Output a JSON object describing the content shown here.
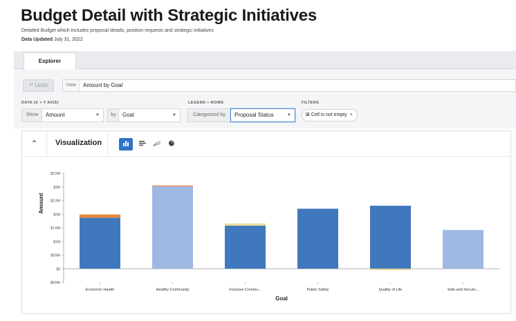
{
  "page": {
    "title": "Budget Detail with Strategic Initiatives",
    "subtitle": "Detailed Budget which includes proposal details, position requests and strategic initiatives",
    "updated_label": "Data Updated",
    "updated_value": "July 31, 2022"
  },
  "tabs": [
    {
      "label": "Explorer"
    }
  ],
  "toolbar": {
    "undo_label": "Undo",
    "undo_icon": "undo-arrow-icon",
    "view_label": "View",
    "view_value": "Amount by Goal"
  },
  "controls": {
    "data_label": "DATA (X + Y AXIS)",
    "show_label": "Show",
    "show_value": "Amount",
    "by_label": "by",
    "by_value": "Goal",
    "legend_label": "LEGEND + ROWS",
    "categorized_label": "Categorized by",
    "categorized_value": "Proposal Status",
    "filters_label": "FILTERS",
    "filter_chip": "Cell is not empty",
    "filter_icon": "filter-square-icon",
    "remove_icon": "close-icon"
  },
  "visualization": {
    "title": "Visualization",
    "collapse_icon": "chevron-up-icon",
    "types": [
      {
        "name": "column-chart-icon",
        "active": true
      },
      {
        "name": "bar-chart-icon",
        "active": false
      },
      {
        "name": "line-chart-icon",
        "active": false
      },
      {
        "name": "pie-chart-icon",
        "active": false
      }
    ]
  },
  "colors": {
    "accent": "#2f74c6",
    "series_dark": "#4078bd",
    "series_light": "#9fb8e3",
    "series_orange": "#e5893a",
    "series_yellow": "#e8dd9a"
  },
  "chart_data": {
    "type": "bar",
    "stacked": true,
    "xlabel": "Goal",
    "ylabel": "Amount",
    "ylim": [
      -500000,
      3500000
    ],
    "yticks": [
      -500000,
      0,
      500000,
      1000000,
      1500000,
      2000000,
      2500000,
      3000000,
      3500000
    ],
    "ytick_labels": [
      "-$500k",
      "$0",
      "$500k",
      "$1M",
      "$1.5M",
      "$2M",
      "$2.5M",
      "$3M",
      "$3.5M"
    ],
    "categories": [
      "Economic Health",
      "Healthy Community",
      "Inclusive Commu...",
      "Public Safety",
      "Quality of Life",
      "Safe and Secure..."
    ],
    "series": [
      {
        "color": "#4078bd",
        "values": [
          1870000,
          0,
          1580000,
          2200000,
          2310000,
          0
        ]
      },
      {
        "color": "#9fb8e3",
        "values": [
          0,
          3020000,
          0,
          0,
          0,
          1420000
        ]
      },
      {
        "color": "#e5893a",
        "values": [
          120000,
          30000,
          0,
          0,
          0,
          0
        ]
      },
      {
        "color": "#e8dd9a",
        "values": [
          0,
          0,
          80000,
          0,
          -50000,
          0
        ]
      }
    ],
    "grid": false,
    "legend": "none"
  }
}
